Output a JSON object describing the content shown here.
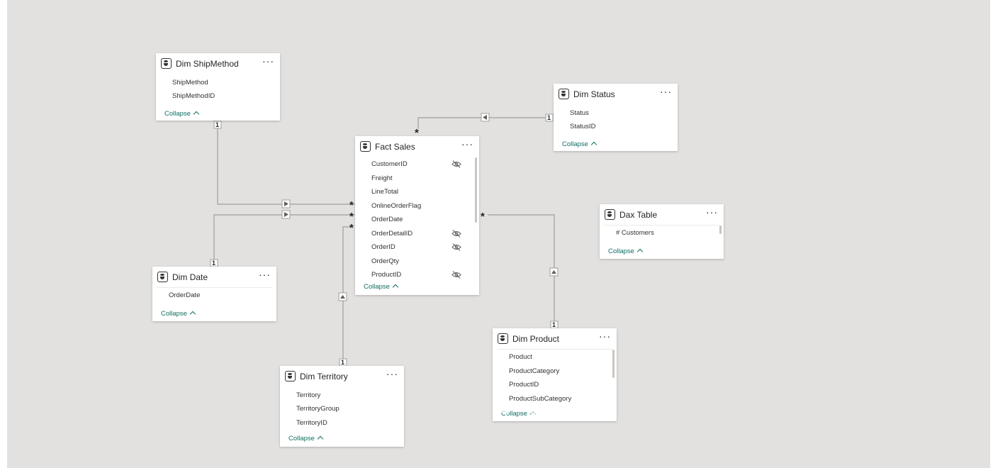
{
  "model": {
    "tables": {
      "dim_shipmethod": {
        "title": "Dim ShipMethod",
        "fields": [
          "ShipMethod",
          "ShipMethodID"
        ],
        "collapse_label": "Collapse"
      },
      "dim_status": {
        "title": "Dim Status",
        "fields": [
          "Status",
          "StatusID"
        ],
        "collapse_label": "Collapse"
      },
      "fact_sales": {
        "title": "Fact Sales",
        "fields": [
          "CustomerID",
          "Freight",
          "LineTotal",
          "OnlineOrderFlag",
          "OrderDate",
          "OrderDetailID",
          "OrderID",
          "OrderQty",
          "ProductID"
        ],
        "hidden_fields": [
          "CustomerID",
          "OrderDetailID",
          "OrderID",
          "ProductID"
        ],
        "collapse_label": "Collapse"
      },
      "dax_table": {
        "title": "Dax Table",
        "fields": [
          "# Customers"
        ],
        "collapse_label": "Collapse"
      },
      "dim_date": {
        "title": "Dim Date",
        "fields": [
          "OrderDate"
        ],
        "collapse_label": "Collapse"
      },
      "dim_product": {
        "title": "Dim Product",
        "fields": [
          "Product",
          "ProductCategory",
          "ProductID",
          "ProductSubCategory"
        ],
        "collapse_label": "Collapse"
      },
      "dim_territory": {
        "title": "Dim Territory",
        "fields": [
          "Territory",
          "TerritoryGroup",
          "TerritoryID"
        ],
        "collapse_label": "Collapse"
      }
    },
    "more_options_label": "···",
    "cardinality": {
      "one": "1",
      "many": "*"
    },
    "relationships": [
      {
        "from": "Dim ShipMethod",
        "to": "Fact Sales",
        "from_card": "1",
        "to_card": "*"
      },
      {
        "from": "Dim Status",
        "to": "Fact Sales",
        "from_card": "1",
        "to_card": "*"
      },
      {
        "from": "Dim Date",
        "to": "Fact Sales",
        "from_card": "1",
        "to_card": "*"
      },
      {
        "from": "Dim Territory",
        "to": "Fact Sales",
        "from_card": "1",
        "to_card": "*"
      },
      {
        "from": "Dim Product",
        "to": "Fact Sales",
        "from_card": "1",
        "to_card": "*"
      }
    ]
  },
  "colors": {
    "canvas": "#e2e1df",
    "line": "#9e9e9e",
    "collapse_text": "#106e63"
  },
  "icons": {
    "table": "database-icon",
    "hidden": "eye-hidden-icon",
    "more": "more-options-icon"
  }
}
